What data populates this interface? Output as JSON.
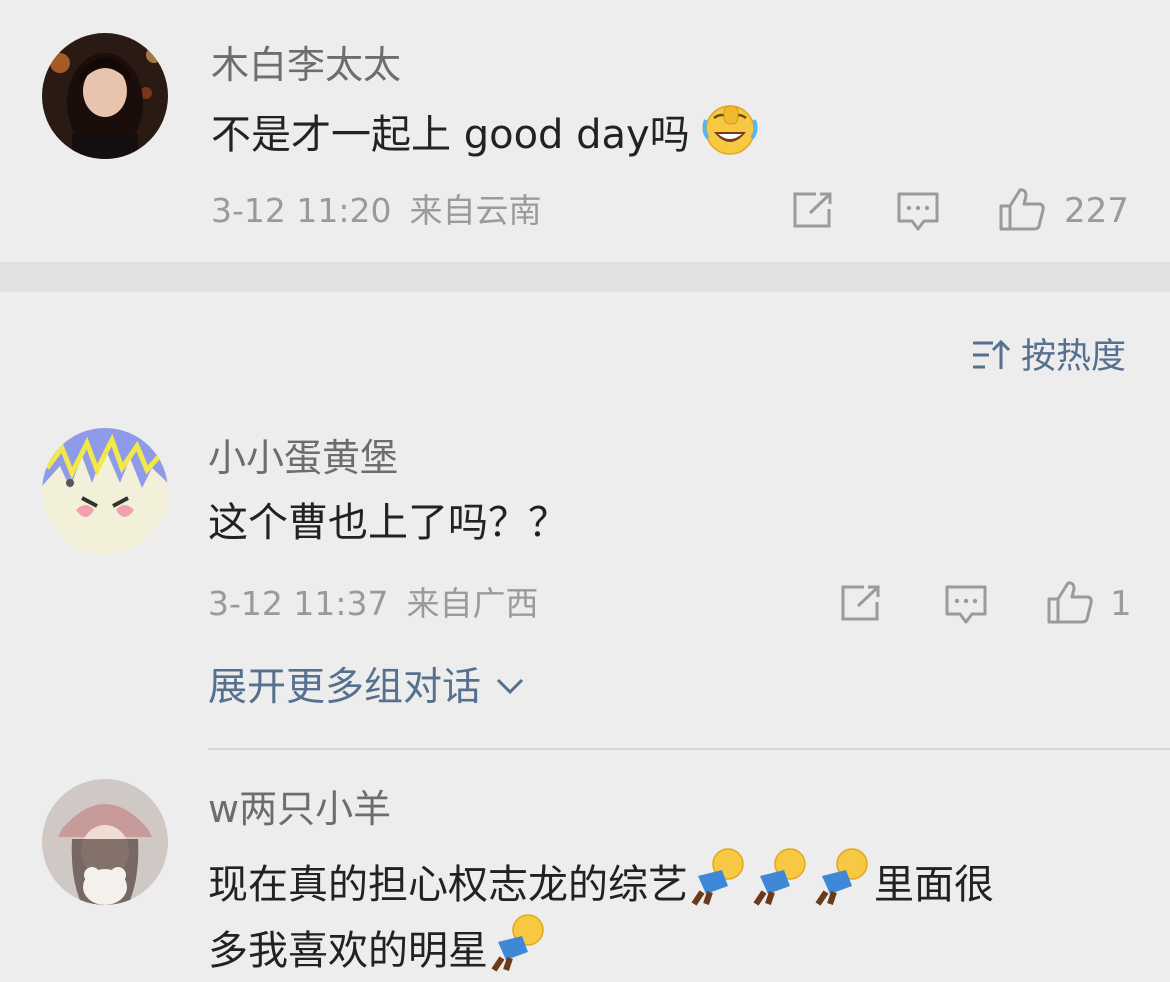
{
  "comments": [
    {
      "username": "木白李太太",
      "text": "不是才一起上 good day吗",
      "emoji": "laughing-crying-emoji",
      "time": "3-12 11:20",
      "location": "来自云南",
      "like_count": "227"
    },
    {
      "username": "小小蛋黄堡",
      "text": "这个曹也上了吗？？",
      "time": "3-12 11:37",
      "location": "来自广西",
      "like_count": "1"
    },
    {
      "username": "w两只小羊",
      "text_line1": "现在真的担心权志龙的综艺",
      "text_line1_end": "里面很",
      "text_line2": "多我喜欢的明星",
      "emoji": "kneeling-figure-emoji"
    }
  ],
  "sort": {
    "label": "按热度"
  },
  "expand": {
    "label": "展开更多组对话"
  },
  "icons": {
    "share": "share-icon",
    "comment": "comment-icon",
    "like": "thumbs-up-icon",
    "sort": "sort-icon",
    "chevron": "chevron-down-icon"
  },
  "colors": {
    "background": "#ededed",
    "link": "#56708f",
    "meta": "#9a9a9a",
    "text": "#222222"
  }
}
